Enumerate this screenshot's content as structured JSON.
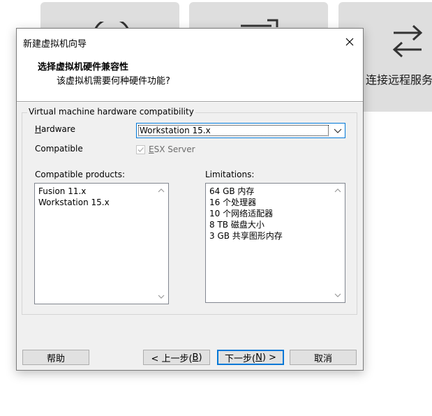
{
  "background": {
    "tile3_label": "连接远程服务"
  },
  "dialog": {
    "window_title": "新建虚拟机向导",
    "header_title": "选择虚拟机硬件兼容性",
    "header_subtitle": "该虚拟机需要何种硬件功能?",
    "group_title": "Virtual machine hardware compatibility",
    "hardware_label_first": "H",
    "hardware_label_rest": "ardware",
    "hardware_value": "Workstation 15.x",
    "compatible_label": "Compatible",
    "esx_label_first": "E",
    "esx_label_rest": "SX Server",
    "esx_checked": true,
    "compatible_products_label": "Compatible products:",
    "compatible_products": [
      "Fusion 11.x",
      "Workstation 15.x"
    ],
    "limitations_label": "Limitations:",
    "limitations": [
      "64 GB 内存",
      "16 个处理器",
      "10 个网络适配器",
      "8 TB 磁盘大小",
      "3 GB 共享图形内存"
    ],
    "buttons": {
      "help": "帮助",
      "back_prefix": "< 上一步(",
      "back_key": "B",
      "back_suffix": ")",
      "next_prefix": "下一步(",
      "next_key": "N",
      "next_suffix": ") >",
      "cancel": "取消"
    }
  },
  "colors": {
    "accent": "#0078d7",
    "dialog_bg": "#f0f0f0",
    "tile_bg": "#dedede"
  }
}
